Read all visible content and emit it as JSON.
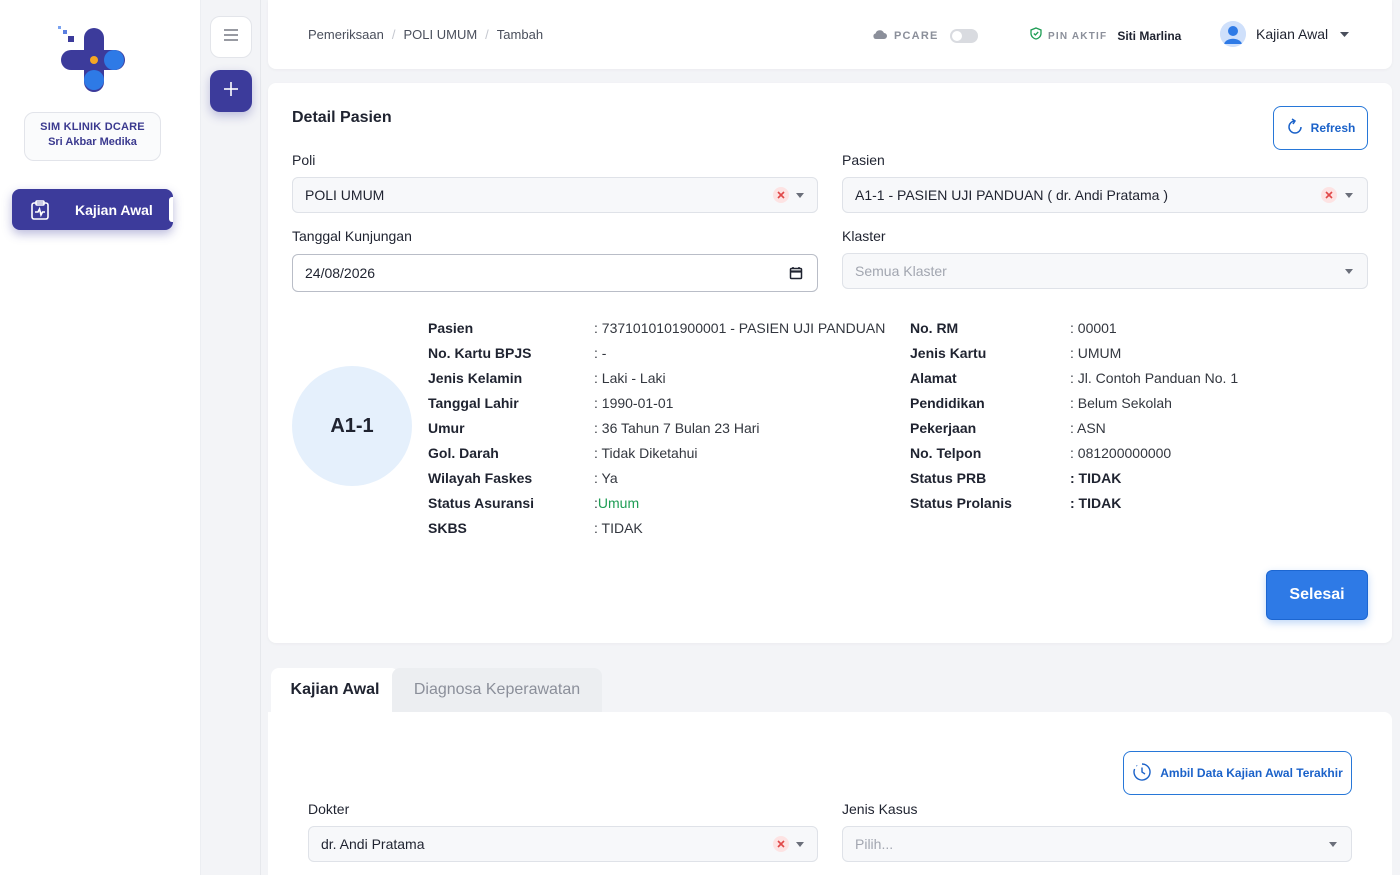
{
  "sidebar": {
    "clinic_line1": "SIM KLINIK DCARE",
    "clinic_line2": "Sri Akbar Medika",
    "active_item": "Kajian Awal"
  },
  "topbar": {
    "breadcrumb": [
      "Pemeriksaan",
      "POLI UMUM",
      "Tambah"
    ],
    "pcare_label": "PCARE",
    "pcare_enabled": false,
    "pin_label": "PIN AKTIF",
    "pin_user": "Siti Marlina",
    "user_menu": "Kajian Awal"
  },
  "detail": {
    "title": "Detail Pasien",
    "refresh_label": "Refresh",
    "poli_label": "Poli",
    "poli_value": "POLI UMUM",
    "pasien_label": "Pasien",
    "pasien_value": "A1-1 - PASIEN UJI PANDUAN ( dr. Andi Pratama )",
    "tanggal_label": "Tanggal Kunjungan",
    "tanggal_value": "24/08/2026",
    "klaster_label": "Klaster",
    "klaster_placeholder": "Semua Klaster",
    "patient_code": "A1-1",
    "left_info": [
      {
        "k": "Pasien",
        "v": ": 7371010101900001 - PASIEN UJI PANDUAN"
      },
      {
        "k": "No. Kartu BPJS",
        "v": ": -"
      },
      {
        "k": "Jenis Kelamin",
        "v": ": Laki - Laki"
      },
      {
        "k": "Tanggal Lahir",
        "v": ": 1990-01-01"
      },
      {
        "k": "Umur",
        "v": ": 36 Tahun 7 Bulan 23 Hari"
      },
      {
        "k": "Gol. Darah",
        "v": ": Tidak Diketahui"
      },
      {
        "k": "Wilayah Faskes",
        "v": ": Ya"
      },
      {
        "k": "Status Asuransi",
        "v_prefix": ": ",
        "v_value": "Umum"
      },
      {
        "k": "SKBS",
        "v": ": TIDAK"
      }
    ],
    "right_info": [
      {
        "k": "No. RM",
        "v": ": 00001"
      },
      {
        "k": "Jenis Kartu",
        "v": ": UMUM"
      },
      {
        "k": "Alamat",
        "v": ": Jl. Contoh Panduan No. 1"
      },
      {
        "k": "Pendidikan",
        "v": ": Belum Sekolah"
      },
      {
        "k": "Pekerjaan",
        "v": ": ASN"
      },
      {
        "k": "No. Telpon",
        "v": ": 081200000000"
      },
      {
        "k": "Status PRB",
        "v": ": TIDAK"
      },
      {
        "k": "Status Prolanis",
        "v": ": TIDAK"
      }
    ],
    "selesai_label": "Selesai"
  },
  "tabs": [
    "Kajian Awal",
    "Diagnosa Keperawatan"
  ],
  "kajian": {
    "ambil_label": "Ambil Data Kajian Awal Terakhir",
    "dokter_label": "Dokter",
    "dokter_value": "dr. Andi Pratama",
    "jenis_kasus_label": "Jenis Kasus",
    "jenis_kasus_placeholder": "Pilih..."
  },
  "colors": {
    "brand": "#3c3b9b",
    "primary": "#2e7ae6",
    "success": "#1f9d55"
  }
}
